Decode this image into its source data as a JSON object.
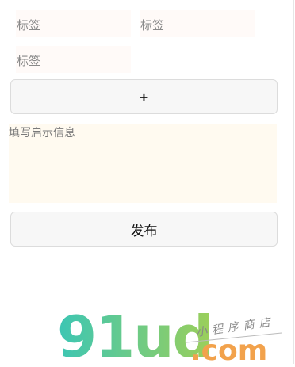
{
  "tags": {
    "placeholder_1": "标签",
    "placeholder_2": "标签",
    "placeholder_3": "标签"
  },
  "add_button": {
    "label": "+"
  },
  "notice": {
    "placeholder": "填写启示信息"
  },
  "publish_button": {
    "label": "发布"
  },
  "watermark": {
    "logo_text": "91ud",
    "domain": ".com",
    "tagline": "小程序商店"
  }
}
